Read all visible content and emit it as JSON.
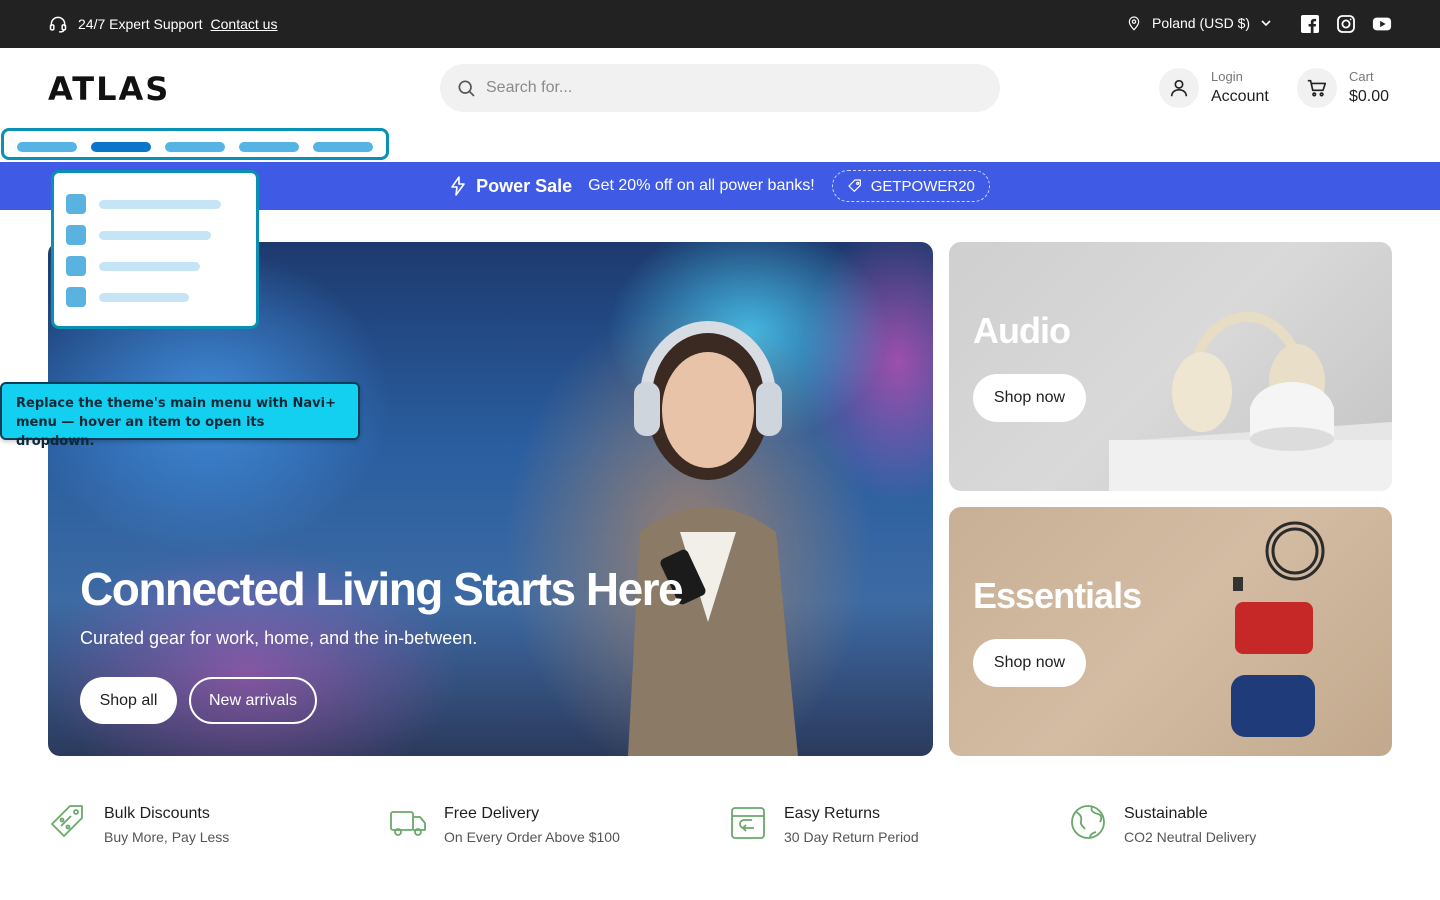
{
  "topbar": {
    "support_text": "24/7 Expert Support",
    "contact_link": "Contact us",
    "locale": "Poland (USD $)",
    "socials": [
      "facebook-icon",
      "instagram-icon",
      "youtube-icon"
    ]
  },
  "header": {
    "logo": "ATLAS",
    "search_placeholder": "Search for...",
    "account_small": "Login",
    "account_big": "Account",
    "cart_small": "Cart",
    "cart_big": "$0.00"
  },
  "promo": {
    "title": "Power Sale",
    "text": "Get 20% off on all power banks!",
    "code": "GETPOWER20",
    "color": "#3f5be6"
  },
  "hero": {
    "title": "Connected Living Starts Here",
    "subtitle": "Curated gear for work, home, and the in-between.",
    "primary_button": "Shop all",
    "secondary_button": "New arrivals"
  },
  "cards": [
    {
      "title": "Audio",
      "button": "Shop now"
    },
    {
      "title": "Essentials",
      "button": "Shop now"
    }
  ],
  "tooltip": {
    "text": "Replace the theme's main menu with Navi+ menu — hover an item to open its dropdown.",
    "color": "#14d0f0"
  },
  "features": [
    {
      "title": "Bulk Discounts",
      "subtitle": "Buy More, Pay Less",
      "icon": "discount-tag-icon"
    },
    {
      "title": "Free Delivery",
      "subtitle": "On Every Order Above $100",
      "icon": "delivery-truck-icon"
    },
    {
      "title": "Easy Returns",
      "subtitle": "30 Day Return Period",
      "icon": "return-box-icon"
    },
    {
      "title": "Sustainable",
      "subtitle": "CO2 Neutral Delivery",
      "icon": "globe-icon"
    }
  ],
  "accent": {
    "feature_icon_color": "#6aa86a",
    "nav_active": "#0b75c9"
  }
}
